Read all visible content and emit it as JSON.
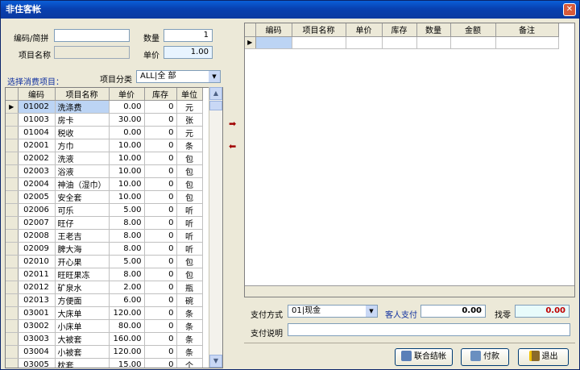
{
  "window": {
    "title": "非住客帐",
    "close_glyph": "✕"
  },
  "form": {
    "code_label": "编码/简拼",
    "code_value": "",
    "qty_label": "数量",
    "qty_value": "1",
    "name_label": "项目名称",
    "name_value": "",
    "price_label": "单价",
    "price_value": "1.00",
    "select_label": "选择消费项目：",
    "category_label": "项目分类",
    "category_value": "ALL|全  部"
  },
  "left_table": {
    "headers": [
      "编码",
      "项目名称",
      "单价",
      "库存",
      "单位"
    ],
    "rows": [
      [
        "01002",
        "洗涤费",
        "0.00",
        "0",
        "元"
      ],
      [
        "01003",
        "房卡",
        "30.00",
        "0",
        "张"
      ],
      [
        "01004",
        "税收",
        "0.00",
        "0",
        "元"
      ],
      [
        "02001",
        "方巾",
        "10.00",
        "0",
        "条"
      ],
      [
        "02002",
        "洗液",
        "10.00",
        "0",
        "包"
      ],
      [
        "02003",
        "浴液",
        "10.00",
        "0",
        "包"
      ],
      [
        "02004",
        "神油（湿巾）",
        "10.00",
        "0",
        "包"
      ],
      [
        "02005",
        "安全套",
        "10.00",
        "0",
        "包"
      ],
      [
        "02006",
        "可乐",
        "5.00",
        "0",
        "听"
      ],
      [
        "02007",
        "旺仔",
        "8.00",
        "0",
        "听"
      ],
      [
        "02008",
        "王老吉",
        "8.00",
        "0",
        "听"
      ],
      [
        "02009",
        "脾大海",
        "8.00",
        "0",
        "听"
      ],
      [
        "02010",
        "开心果",
        "5.00",
        "0",
        "包"
      ],
      [
        "02011",
        "旺旺果冻",
        "8.00",
        "0",
        "包"
      ],
      [
        "02012",
        "矿泉水",
        "2.00",
        "0",
        "瓶"
      ],
      [
        "02013",
        "方便面",
        "6.00",
        "0",
        "碗"
      ],
      [
        "03001",
        "大床单",
        "120.00",
        "0",
        "条"
      ],
      [
        "03002",
        "小床单",
        "80.00",
        "0",
        "条"
      ],
      [
        "03003",
        "大被套",
        "160.00",
        "0",
        "条"
      ],
      [
        "03004",
        "小被套",
        "120.00",
        "0",
        "条"
      ],
      [
        "03005",
        "枕套",
        "15.00",
        "0",
        "个"
      ]
    ]
  },
  "right_table": {
    "headers": [
      "编码",
      "项目名称",
      "单价",
      "库存",
      "数量",
      "金额",
      "备注"
    ]
  },
  "payment": {
    "method_label": "支付方式",
    "method_value": "01|现金",
    "guest_pay_label": "客人支付",
    "guest_pay_value": "0.00",
    "change_label": "找零",
    "change_value": "0.00",
    "note_label": "支付说明",
    "note_value": ""
  },
  "buttons": {
    "combined_checkout": "联合结帐",
    "pay": "付款",
    "exit": "退出"
  },
  "glyphs": {
    "row_pointer": "▶",
    "arrow_right": "➡",
    "arrow_left": "⬅",
    "scroll_up": "▲",
    "scroll_down": "▼",
    "dropdown": "▼"
  },
  "colors": {
    "title_bar": "#0a5fd8",
    "selected_row": "#bcd4f4",
    "price_field": "#e8f4ff",
    "change_field": "#e8fbfb",
    "change_text": "#c00000",
    "guest_pay_label": "#1030a0"
  }
}
